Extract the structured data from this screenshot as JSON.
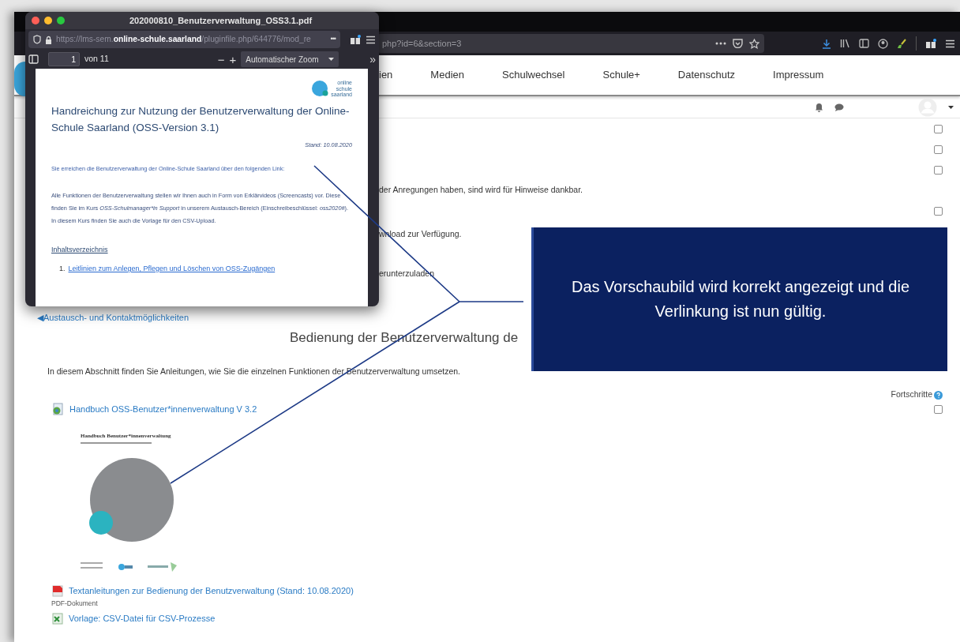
{
  "browser": {
    "url_visible": "php?id=6&section=3"
  },
  "nav": {
    "items": [
      "ien",
      "Medien",
      "Schulwechsel",
      "Schule+",
      "Datenschutz",
      "Impressum"
    ]
  },
  "upper_rows": [
    {
      "kind": "check",
      "checked": false
    },
    {
      "kind": "check",
      "checked": false
    },
    {
      "kind": "check",
      "checked": false
    },
    {
      "kind": "text",
      "text": "der Anregungen haben, sind wird für Hinweise  dankbar."
    },
    {
      "kind": "check",
      "checked": false
    },
    {
      "kind": "text",
      "text": "wnload zur Verfügung."
    },
    {
      "kind": "text",
      "text": "erunterzuladen"
    }
  ],
  "back_link": {
    "arrow": "◀",
    "text": "Austausch- und Kontaktmöglichkeiten"
  },
  "section": {
    "heading": "Bedienung der Benutzerverwaltung de",
    "intro": "In diesem Abschnitt finden Sie Anleitungen, wie Sie die einzelnen Funktionen der Benutzerverwaltung umsetzen.",
    "progress_label": "Fortschritte",
    "activities": [
      {
        "kind": "page",
        "title": "Handbuch OSS-Benutzer*innenverwaltung V 3.2",
        "checked": false,
        "cover_title": "Handbuch Benutzer*innenverwaltung"
      },
      {
        "kind": "pdf",
        "title": "Textanleitungen zur Bedienung der Benutzverwaltung (Stand: 10.08.2020)",
        "subtitle": "PDF-Dokument"
      },
      {
        "kind": "csv",
        "title": "Vorlage: CSV-Datei für CSV-Prozesse"
      }
    ]
  },
  "pdf_window": {
    "title": "202000810_Benutzerverwaltung_OSS3.1.pdf",
    "url": {
      "prefix": "https://lms-sem.",
      "domain": "online-schule.saarland",
      "path": "/pluginfile.php/644776/mod_re"
    },
    "url_more": "•••",
    "page_number": "1",
    "page_count": "von 11",
    "zoom_out": "−",
    "zoom_in": "+",
    "zoom": "Automatischer Zoom",
    "more_tools": "»",
    "document": {
      "logo_text": [
        "online",
        "schule",
        "saarland"
      ],
      "heading": "Handreichung zur Nutzung der Benutzerverwaltung der Online-Schule Saarland (OSS-Version 3.1)",
      "date": "Stand: 10.08.2020",
      "paragraphs": [
        {
          "parts": [
            {
              "text": "Sie erreichen die Benutzerverwaltung der Online-Schule Saarland über den folgenden Link:",
              "italic": false
            }
          ]
        },
        {
          "parts": [
            {
              "text": "Alle Funktionen der Benutzerverwaltung stellen wir Ihnen auch in Form von Erklärvideos (Screencasts) vor. Diese finden Sie im Kurs ",
              "italic": false
            },
            {
              "text": "OSS-Schulmanager*in Support",
              "italic": true
            },
            {
              "text": " in unserem Austausch-Bereich (Einschreibeschlüssel: ",
              "italic": false
            },
            {
              "text": "oss2020#",
              "italic": true
            },
            {
              "text": "). In diesem Kurs finden Sie auch die Vorlage für den CSV-Upload.",
              "italic": false
            }
          ]
        }
      ],
      "toc_heading": "Inhaltsverzeichnis",
      "toc": [
        {
          "number": "1.",
          "text": "Leitlinien zum Anlegen, Pflegen und Löschen von OSS-Zugängen"
        }
      ]
    }
  },
  "callout": {
    "text": "Das Vorschaubild wird korrekt angezeigt und die Verlinkung ist nun gültig."
  }
}
